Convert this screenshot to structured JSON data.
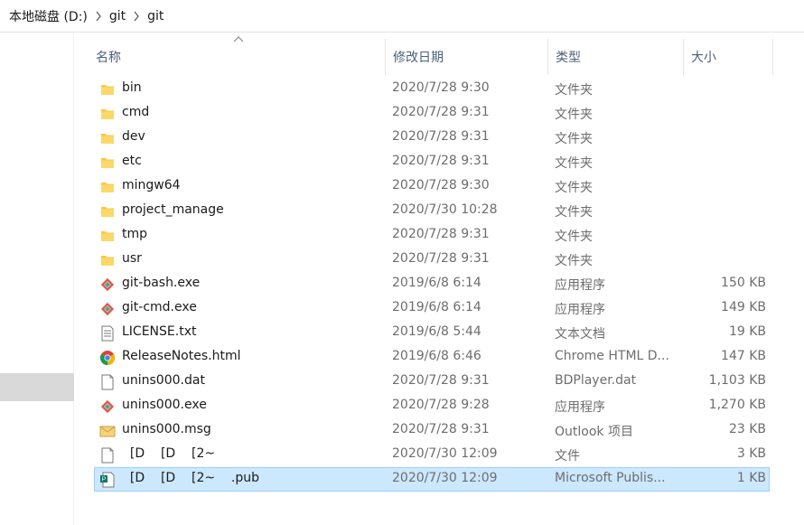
{
  "breadcrumb": {
    "items": [
      "本地磁盘 (D:)",
      "git",
      "git"
    ]
  },
  "columns": {
    "name": "名称",
    "date": "修改日期",
    "type": "类型",
    "size": "大小"
  },
  "colors": {
    "selection_bg": "#cce8ff",
    "selection_border": "#99d1ff",
    "folder": "#f8c94a",
    "header_text": "#4c607a"
  },
  "files": [
    {
      "name": "bin",
      "date": "2020/7/28 9:30",
      "type": "文件夹",
      "size": "",
      "icon": "folder-icon"
    },
    {
      "name": "cmd",
      "date": "2020/7/28 9:31",
      "type": "文件夹",
      "size": "",
      "icon": "folder-icon"
    },
    {
      "name": "dev",
      "date": "2020/7/28 9:31",
      "type": "文件夹",
      "size": "",
      "icon": "folder-icon"
    },
    {
      "name": "etc",
      "date": "2020/7/28 9:31",
      "type": "文件夹",
      "size": "",
      "icon": "folder-icon"
    },
    {
      "name": "mingw64",
      "date": "2020/7/28 9:30",
      "type": "文件夹",
      "size": "",
      "icon": "folder-icon"
    },
    {
      "name": "project_manage",
      "date": "2020/7/30 10:28",
      "type": "文件夹",
      "size": "",
      "icon": "folder-icon"
    },
    {
      "name": "tmp",
      "date": "2020/7/28 9:31",
      "type": "文件夹",
      "size": "",
      "icon": "folder-icon"
    },
    {
      "name": "usr",
      "date": "2020/7/28 9:31",
      "type": "文件夹",
      "size": "",
      "icon": "folder-icon"
    },
    {
      "name": "git-bash.exe",
      "date": "2019/6/8 6:14",
      "type": "应用程序",
      "size": "150 KB",
      "icon": "git-icon"
    },
    {
      "name": "git-cmd.exe",
      "date": "2019/6/8 6:14",
      "type": "应用程序",
      "size": "149 KB",
      "icon": "git-icon"
    },
    {
      "name": "LICENSE.txt",
      "date": "2019/6/8 5:44",
      "type": "文本文档",
      "size": "19 KB",
      "icon": "text-document-icon"
    },
    {
      "name": "ReleaseNotes.html",
      "date": "2019/6/8 6:46",
      "type": "Chrome HTML D...",
      "size": "147 KB",
      "icon": "chrome-icon"
    },
    {
      "name": "unins000.dat",
      "date": "2020/7/28 9:31",
      "type": "BDPlayer.dat",
      "size": "1,103 KB",
      "icon": "blank-file-icon"
    },
    {
      "name": "unins000.exe",
      "date": "2020/7/28 9:28",
      "type": "应用程序",
      "size": "1,270 KB",
      "icon": "git-icon"
    },
    {
      "name": "unins000.msg",
      "date": "2020/7/28 9:31",
      "type": "Outlook 项目",
      "size": "23 KB",
      "icon": "mail-icon"
    },
    {
      "name": "  [D    [D    [2~",
      "date": "2020/7/30 12:09",
      "type": "文件",
      "size": "3 KB",
      "icon": "blank-file-icon"
    },
    {
      "name": "  [D    [D    [2~    .pub",
      "date": "2020/7/30 12:09",
      "type": "Microsoft Publis...",
      "size": "1 KB",
      "icon": "publisher-icon",
      "selected": true
    }
  ]
}
